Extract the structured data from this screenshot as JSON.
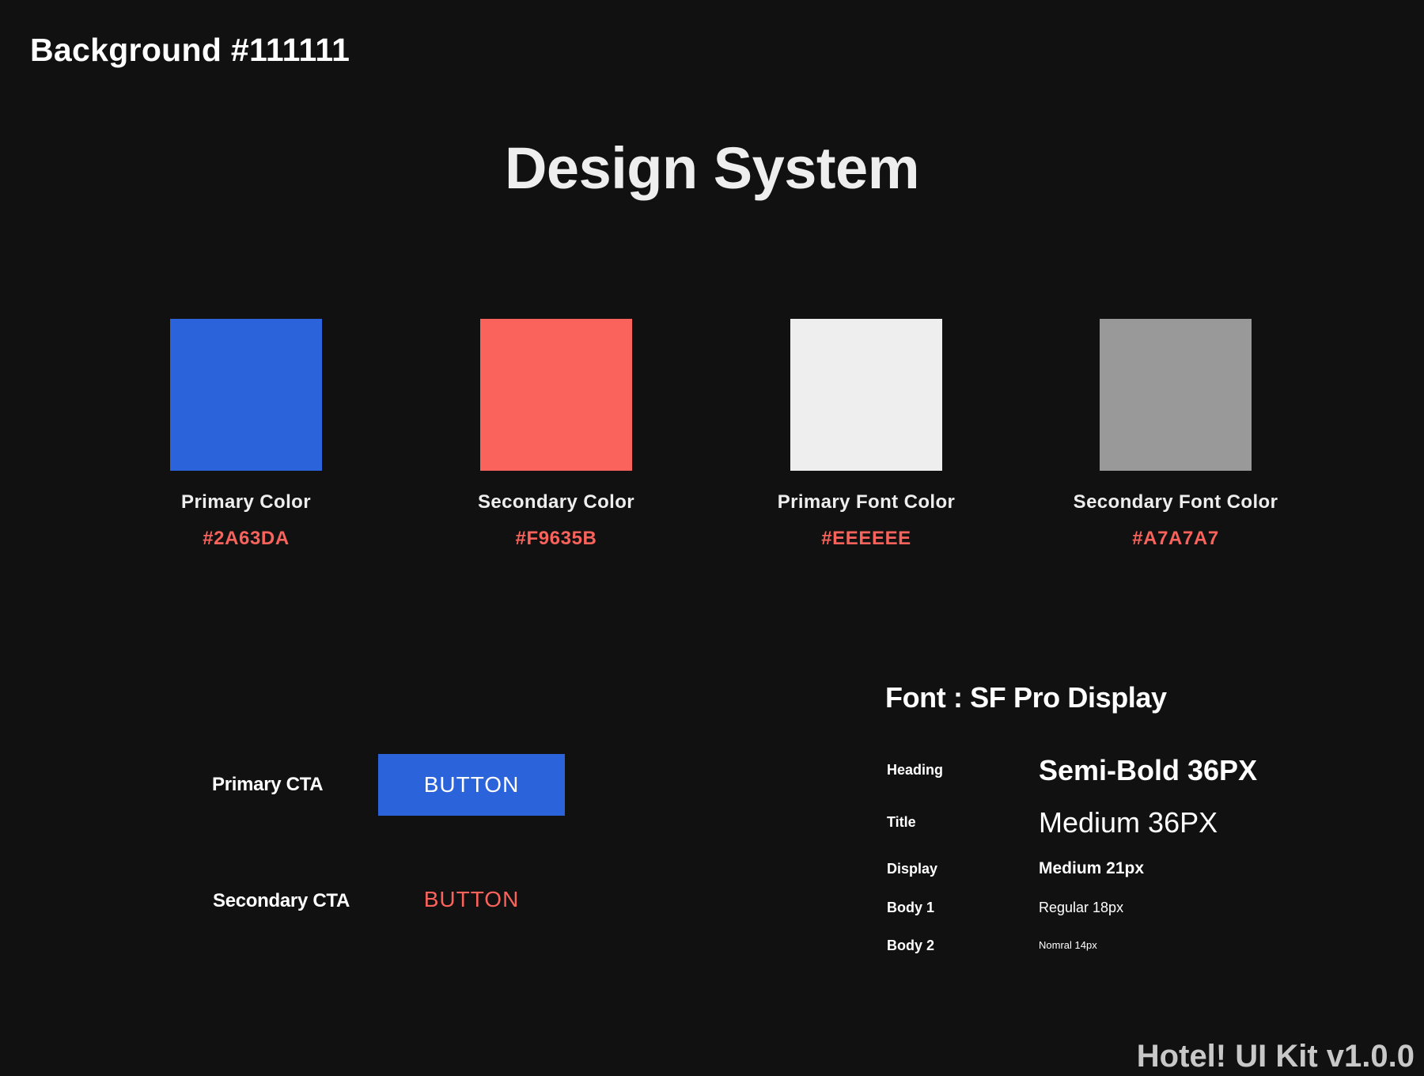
{
  "background_label": "Background #111111",
  "title": "Design System",
  "colors": [
    {
      "name": "Primary Color",
      "hex": "#2A63DA",
      "swatch": "#2A63DA"
    },
    {
      "name": "Secondary Color",
      "hex": "#F9635B",
      "swatch": "#F9635B"
    },
    {
      "name": "Primary Font Color",
      "hex": "#EEEEEE",
      "swatch": "#EEEEEE"
    },
    {
      "name": "Secondary Font Color",
      "hex": "#A7A7A7",
      "swatch": "#999999"
    }
  ],
  "ctas": {
    "primary_label": "Primary CTA",
    "primary_button": "BUTTON",
    "secondary_label": "Secondary CTA",
    "secondary_button": "BUTTON"
  },
  "typography": {
    "font_title": "Font : SF Pro Display",
    "styles": [
      {
        "label": "Heading",
        "sample": "Semi-Bold 36PX"
      },
      {
        "label": "Title",
        "sample": "Medium 36PX"
      },
      {
        "label": "Display",
        "sample": "Medium 21px"
      },
      {
        "label": "Body 1",
        "sample": "Regular 18px"
      },
      {
        "label": "Body 2",
        "sample": "Nomral 14px"
      }
    ]
  },
  "version": "Hotel! UI Kit v1.0.0"
}
